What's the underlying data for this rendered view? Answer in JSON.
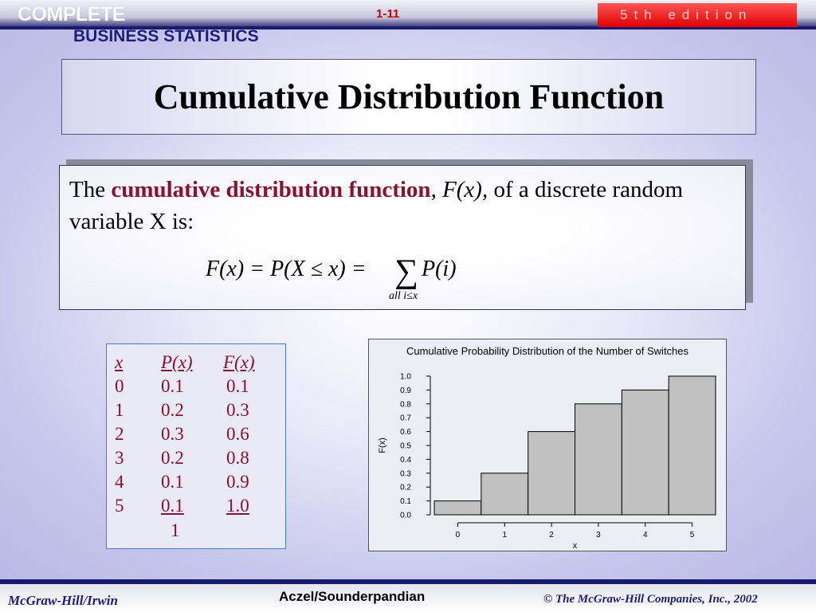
{
  "header": {
    "logo_line1": "COMPLETE",
    "logo_line2": "BUSINESS STATISTICS",
    "slide_number": "1-11",
    "edition": "5th edition"
  },
  "slide": {
    "title": "Cumulative Distribution Function",
    "definition": {
      "prefix": "The ",
      "term": "cumulative distribution function",
      "after_term": ", ",
      "symbol": "F(x)",
      "suffix": ", of a discrete random variable X is:"
    },
    "formula": {
      "main": "F(x) = P(X ≤ x) = ",
      "sigma": "∑",
      "summand": "P(i)",
      "subscript": "all i≤x"
    }
  },
  "table": {
    "headers": [
      "x",
      "P(x)",
      "F(x)"
    ],
    "rows": [
      [
        "0",
        "0.1",
        "0.1"
      ],
      [
        "1",
        "0.2",
        "0.3"
      ],
      [
        "2",
        "0.3",
        "0.6"
      ],
      [
        "3",
        "0.2",
        "0.8"
      ],
      [
        "4",
        "0.1",
        "0.9"
      ],
      [
        "5",
        "0.1",
        "1.0"
      ]
    ],
    "total": "1"
  },
  "chart_data": {
    "type": "bar",
    "title": "Cumulative Probability Distribution of the Number of Switches",
    "xlabel": "x",
    "ylabel": "F(x)",
    "categories": [
      "0",
      "1",
      "2",
      "3",
      "4",
      "5"
    ],
    "values": [
      0.1,
      0.3,
      0.6,
      0.8,
      0.9,
      1.0
    ],
    "ylim": [
      0,
      1.0
    ],
    "yticks": [
      "0.0",
      "0.1",
      "0.2",
      "0.3",
      "0.4",
      "0.5",
      "0.6",
      "0.7",
      "0.8",
      "0.9",
      "1.0"
    ],
    "bar_color": "#c0c0c0",
    "grid": false,
    "legend": "none"
  },
  "footer": {
    "left": "McGraw-Hill/Irwin",
    "center": "Aczel/Sounderpandian",
    "right": "© The McGraw-Hill Companies, Inc., 2002"
  }
}
